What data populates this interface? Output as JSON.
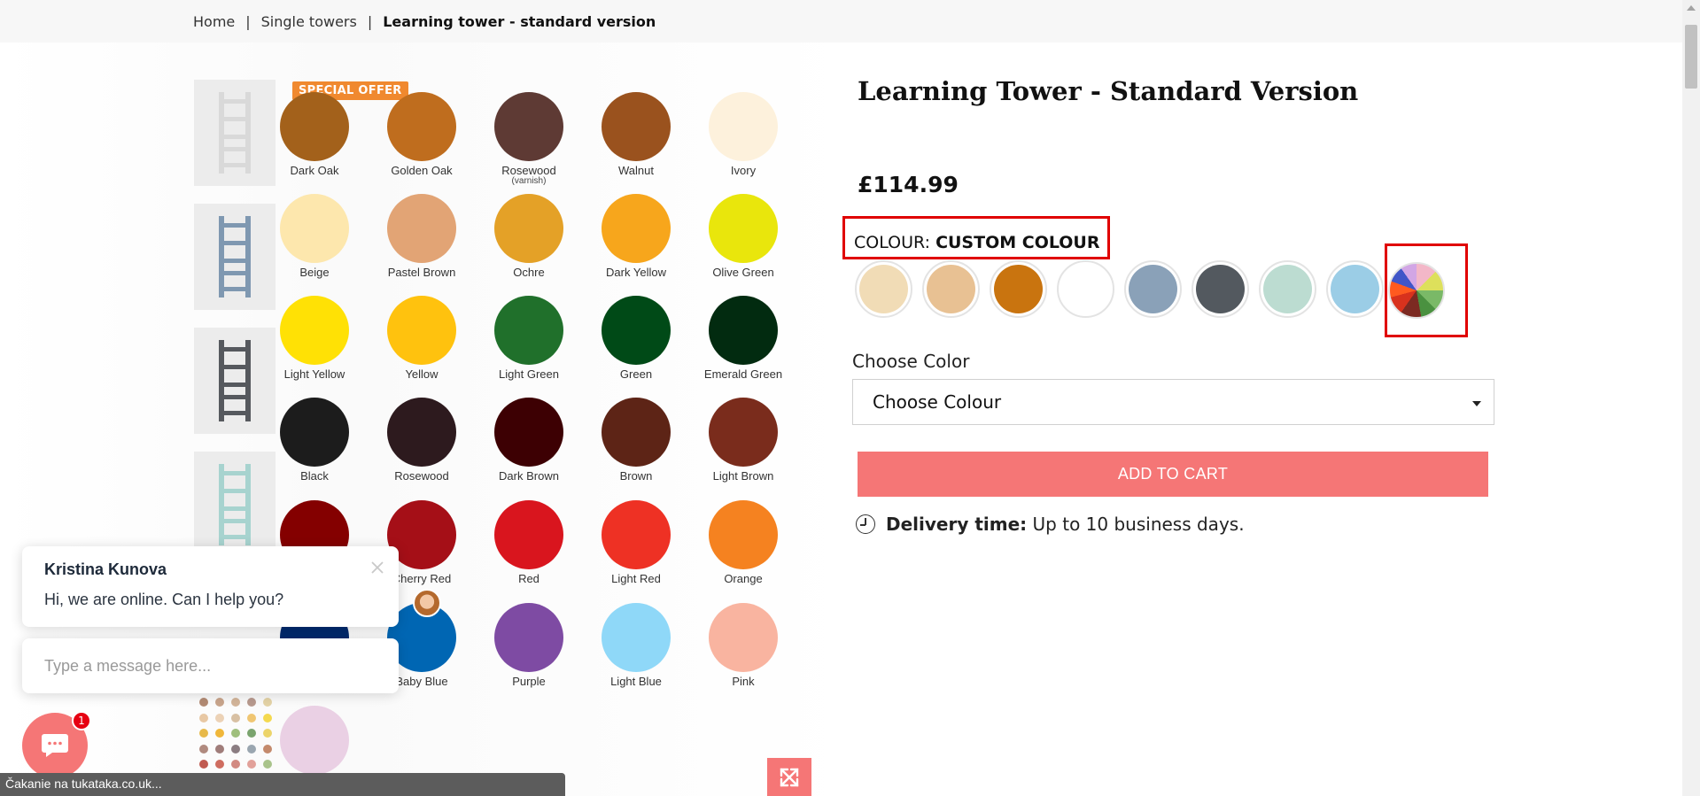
{
  "breadcrumb": {
    "items": [
      "Home",
      "Single towers",
      "Learning tower - standard version"
    ],
    "separator": "|"
  },
  "gallery": {
    "special_offer_badge": "SPECIAL OFFER",
    "thumbnails": [
      {
        "name": "white-tower",
        "color": "#d9d9d9"
      },
      {
        "name": "blue-grey-tower",
        "color": "#7f98b1"
      },
      {
        "name": "dark-grey-tower",
        "color": "#56595e"
      },
      {
        "name": "mint-tower",
        "color": "#a7d3cf"
      }
    ],
    "color_grid": [
      {
        "name": "Dark Oak",
        "color": "#a3611b"
      },
      {
        "name": "Golden Oak",
        "color": "#bf6d1e"
      },
      {
        "name": "Rosewood",
        "sub": "(varnish)",
        "color": "#5e3a34"
      },
      {
        "name": "Walnut",
        "color": "#9a521e"
      },
      {
        "name": "Ivory",
        "color": "#fdf1dc"
      },
      {
        "name": "Beige",
        "color": "#fde7ad"
      },
      {
        "name": "Pastel Brown",
        "color": "#e2a475"
      },
      {
        "name": "Ochre",
        "color": "#e4a127"
      },
      {
        "name": "Dark Yellow",
        "color": "#f7a61c"
      },
      {
        "name": "Olive Green",
        "color": "#e9e60c"
      },
      {
        "name": "Light Yellow",
        "color": "#ffe105"
      },
      {
        "name": "Yellow",
        "color": "#ffc20e"
      },
      {
        "name": "Light Green",
        "color": "#20702b"
      },
      {
        "name": "Green",
        "color": "#004a17"
      },
      {
        "name": "Emerald Green",
        "color": "#022b10"
      },
      {
        "name": "Black",
        "color": "#1c1c1c"
      },
      {
        "name": "Rosewood",
        "color": "#2d1a1e"
      },
      {
        "name": "Dark Brown",
        "color": "#3d0003"
      },
      {
        "name": "Brown",
        "color": "#5d2416"
      },
      {
        "name": "Light Brown",
        "color": "#7a2c1c"
      },
      {
        "name": "",
        "color": "#840000"
      },
      {
        "name": "Cherry Red",
        "color": "#a50f17"
      },
      {
        "name": "Red",
        "color": "#d9151e"
      },
      {
        "name": "Light Red",
        "color": "#ee3124"
      },
      {
        "name": "Orange",
        "color": "#f58220"
      },
      {
        "name": "",
        "color": "#002a6d"
      },
      {
        "name": "Baby Blue",
        "color": "#0066b3"
      },
      {
        "name": "Purple",
        "color": "#7e4ba3"
      },
      {
        "name": "Light Blue",
        "color": "#8fd8f8"
      },
      {
        "name": "Pink",
        "color": "#f9b4a0"
      },
      {
        "name": "",
        "color": "#ead0e4"
      }
    ],
    "dot_sample_colors": [
      "#b38b74",
      "#c9a58c",
      "#d3b59a",
      "#b89a8e",
      "#e4d3a6",
      "#e8c8a4",
      "#ecd2b6",
      "#d8c0a3",
      "#f0c672",
      "#f4d94f",
      "#e7b94a",
      "#f0b73a",
      "#9fbf7d",
      "#7aa46e",
      "#ecd46a",
      "#b08a7f",
      "#a07d7a",
      "#8b7d82",
      "#9aa6b0",
      "#c48a6c",
      "#c05a50",
      "#cf6d60",
      "#d28a82",
      "#e2a19a",
      "#a9c38b"
    ]
  },
  "product": {
    "title": "Learning Tower - Standard Version",
    "price": "£114.99",
    "colour_label": "COLOUR:",
    "colour_value": "CUSTOM COLOUR",
    "colour_options": [
      {
        "name": "natural-light",
        "color": "#f1dcb6"
      },
      {
        "name": "natural-beech",
        "color": "#e8c193"
      },
      {
        "name": "golden-oak",
        "color": "#c9740f"
      },
      {
        "name": "white",
        "color": "#ffffff"
      },
      {
        "name": "blue-grey",
        "color": "#8aa1b8"
      },
      {
        "name": "anthracite",
        "color": "#53595f"
      },
      {
        "name": "mint",
        "color": "#bcdcd1"
      },
      {
        "name": "light-blue",
        "color": "#9bcde6"
      }
    ],
    "choose_color_label": "Choose Color",
    "select_value": "Choose Colour",
    "add_to_cart": "ADD TO CART",
    "delivery_label": "Delivery time:",
    "delivery_value": "Up to 10 business days."
  },
  "chat": {
    "agent_name": "Kristina Kunova",
    "message": "Hi, we are online. Can I help you?",
    "input_placeholder": "Type a message here...",
    "badge_count": "1"
  },
  "status_bar": {
    "text": "Čakanie na tukataka.co.uk..."
  }
}
